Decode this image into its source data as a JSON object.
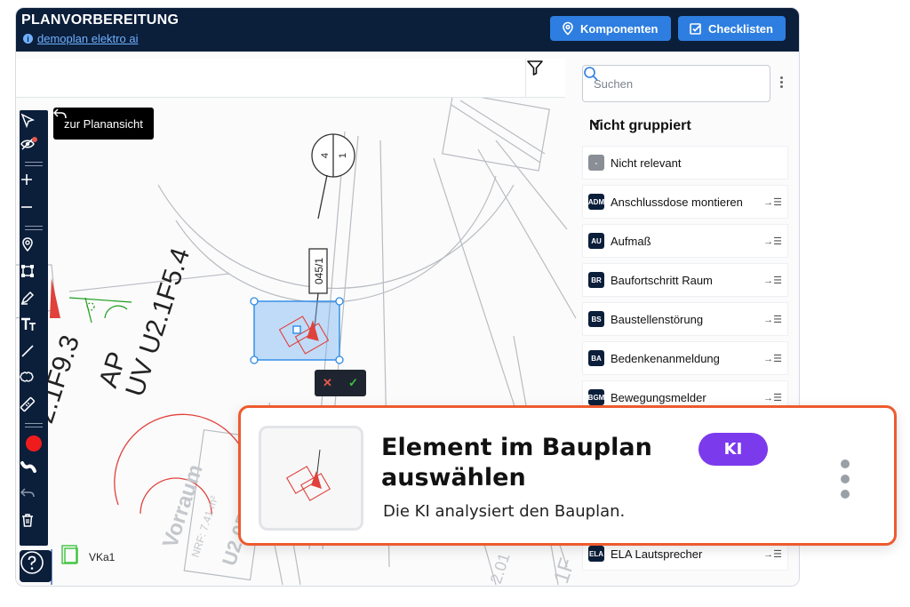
{
  "header": {
    "title": "PLANVORBEREITUNG",
    "project": "demoplan elektro ai",
    "btn_components": "Komponenten",
    "btn_checklists": "Checklisten"
  },
  "plan": {
    "back_button": "zur Planansicht",
    "labels": {
      "uv": "UV U2.1F5.4",
      "ap": "AP",
      "f93": "2.1F9.3",
      "vorraum": "Vorraum",
      "nrf": "NRF: 7.41 m²",
      "u2": "U2.05",
      "vka1": "VKa1",
      "tag": "045/1",
      "circle_top": "4",
      "circle_bottom": "1",
      "f": "1F",
      "o2": "2.01"
    }
  },
  "panel": {
    "search_placeholder": "Suchen",
    "group_title": "Nicht gruppiert",
    "items": [
      {
        "badge": "-",
        "label": "Nicht relevant"
      },
      {
        "badge": "ADM",
        "label": "Anschlussdose montieren"
      },
      {
        "badge": "AU",
        "label": "Aufmaß"
      },
      {
        "badge": "BR",
        "label": "Baufortschritt Raum"
      },
      {
        "badge": "BS",
        "label": "Baustellenstörung"
      },
      {
        "badge": "BA",
        "label": "Bedenkenanmeldung"
      },
      {
        "badge": "BGM",
        "label": "Bewegungsmelder"
      },
      {
        "badge": "ELA",
        "label": "ELA Lautsprecher"
      }
    ],
    "assign_glyph": "→☰"
  },
  "card": {
    "title": "Element im Bauplan auswählen",
    "subtitle": "Die KI analysiert den Bauplan.",
    "badge": "KI"
  },
  "colors": {
    "header_bg": "#0b1e3a",
    "accent": "#2d7ee0",
    "card_border": "#ee5a2e",
    "ki_purple": "#7c3aed"
  }
}
